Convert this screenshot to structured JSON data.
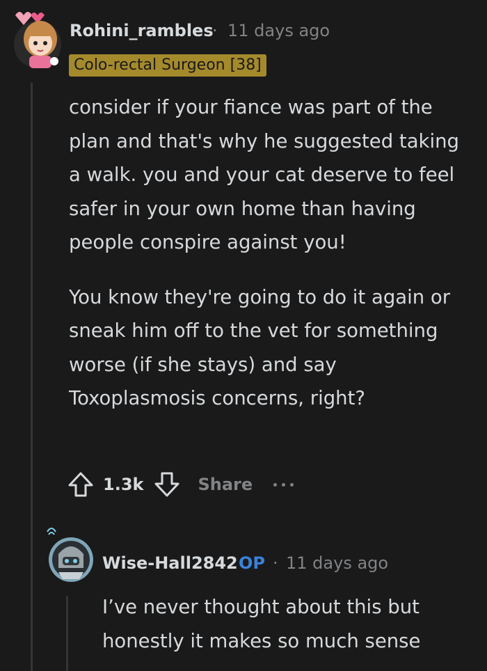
{
  "comment": {
    "author": "Rohini_rambles",
    "separator": "·",
    "timestamp": "11 days ago",
    "flair": "Colo-rectal Surgeon [38]",
    "paragraphs": [
      "consider if your fiance was part of the plan and that's why he suggested taking a walk. you and your cat deserve to feel safer in your own home than having people conspire against you!",
      "You know they're going to do it again or sneak him off to the vet for something worse (if she stays) and say Toxoplasmosis concerns, right?"
    ],
    "score": "1.3k",
    "share_label": "Share",
    "avatar_icon": "anime-girl-avatar-icon"
  },
  "reply": {
    "author": "Wise-Hall2842",
    "op_badge": "OP",
    "separator": "·",
    "timestamp": "11 days ago",
    "text": "I’ve never thought about this but honestly it makes so much sense",
    "avatar_icon": "robot-avatar-icon"
  },
  "icons": {
    "upvote": "arrow-up-icon",
    "downvote": "arrow-down-icon",
    "more": "more-dots-icon"
  },
  "colors": {
    "background": "#1a1a1b",
    "flair_bg": "#a58a2c",
    "op_blue": "#3b82d9",
    "muted": "#818384",
    "text": "#d7dadc"
  }
}
